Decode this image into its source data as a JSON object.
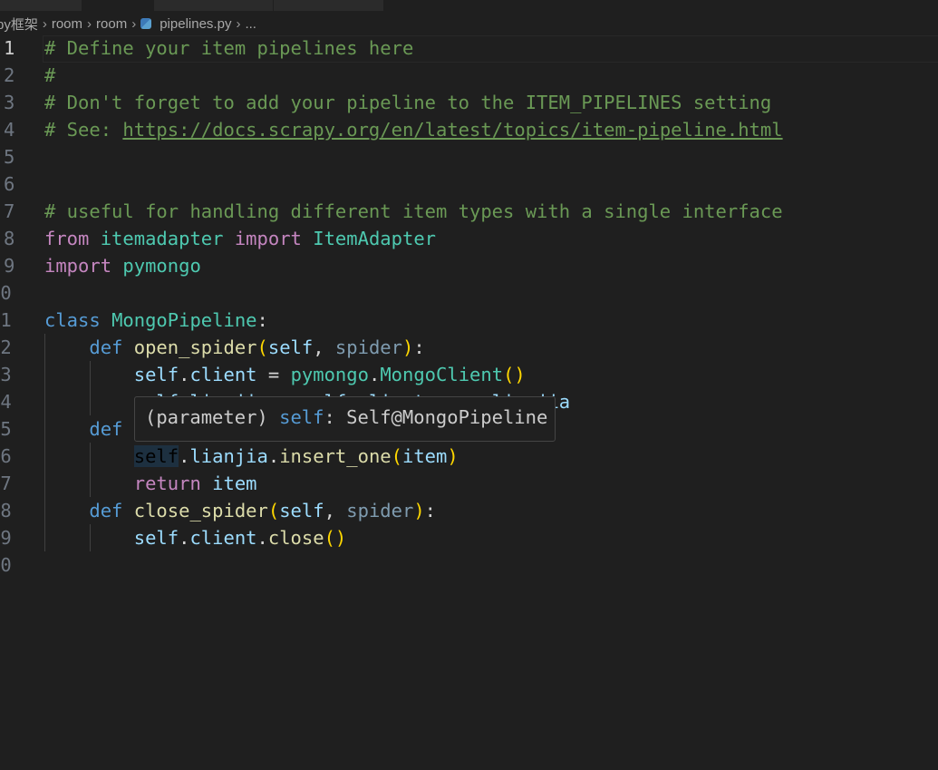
{
  "breadcrumb": [
    "py框架",
    "room",
    "room",
    "pipelines.py",
    "..."
  ],
  "file_icon": "python-icon",
  "current_line": 1,
  "lines": [
    [
      [
        "c",
        "# Define your item pipelines here"
      ]
    ],
    [
      [
        "c",
        "#"
      ]
    ],
    [
      [
        "c",
        "# Don't forget to add your pipeline to the ITEM_PIPELINES setting"
      ]
    ],
    [
      [
        "c",
        "# See: "
      ],
      [
        "u",
        "https://docs.scrapy.org/en/latest/topics/item-pipeline.html"
      ]
    ],
    [],
    [],
    [
      [
        "c",
        "# useful for handling different item types with a single interface"
      ]
    ],
    [
      [
        "k",
        "from"
      ],
      [
        "p",
        " "
      ],
      [
        "t",
        "itemadapter"
      ],
      [
        "p",
        " "
      ],
      [
        "k",
        "import"
      ],
      [
        "p",
        " "
      ],
      [
        "t",
        "ItemAdapter"
      ]
    ],
    [
      [
        "k",
        "import"
      ],
      [
        "p",
        " "
      ],
      [
        "t",
        "pymongo"
      ]
    ],
    [],
    [
      [
        "d",
        "class"
      ],
      [
        "p",
        " "
      ],
      [
        "t",
        "MongoPipeline"
      ],
      [
        "p",
        ":"
      ]
    ],
    [
      [
        "p",
        "    "
      ],
      [
        "d",
        "def"
      ],
      [
        "p",
        " "
      ],
      [
        "f",
        "open_spider"
      ],
      [
        "b",
        "("
      ],
      [
        "v",
        "self"
      ],
      [
        "p",
        ", "
      ],
      [
        "dim",
        "spider"
      ],
      [
        "b",
        ")"
      ],
      [
        "p",
        ":"
      ]
    ],
    [
      [
        "p",
        "        "
      ],
      [
        "v",
        "self"
      ],
      [
        "p",
        "."
      ],
      [
        "v",
        "client"
      ],
      [
        "p",
        " = "
      ],
      [
        "t",
        "pymongo"
      ],
      [
        "p",
        "."
      ],
      [
        "t",
        "MongoClient"
      ],
      [
        "b",
        "()"
      ]
    ],
    [
      [
        "p",
        "        "
      ],
      [
        "v",
        "self"
      ],
      [
        "p",
        "."
      ],
      [
        "v",
        "lianjia"
      ],
      [
        "p",
        " = "
      ],
      [
        "v",
        "self"
      ],
      [
        "p",
        "."
      ],
      [
        "v",
        "client"
      ],
      [
        "p",
        "."
      ],
      [
        "v",
        "room"
      ],
      [
        "p",
        "."
      ],
      [
        "v",
        "lianjia"
      ]
    ],
    [
      [
        "p",
        "    "
      ],
      [
        "d",
        "def"
      ]
    ],
    [
      [
        "p",
        "        "
      ],
      [
        "hl",
        "self"
      ],
      [
        "p",
        "."
      ],
      [
        "v",
        "lianjia"
      ],
      [
        "p",
        "."
      ],
      [
        "f",
        "insert_one"
      ],
      [
        "b",
        "("
      ],
      [
        "v",
        "item"
      ],
      [
        "b",
        ")"
      ]
    ],
    [
      [
        "p",
        "        "
      ],
      [
        "k",
        "return"
      ],
      [
        "p",
        " "
      ],
      [
        "v",
        "item"
      ]
    ],
    [
      [
        "p",
        "    "
      ],
      [
        "d",
        "def"
      ],
      [
        "p",
        " "
      ],
      [
        "f",
        "close_spider"
      ],
      [
        "b",
        "("
      ],
      [
        "v",
        "self"
      ],
      [
        "p",
        ", "
      ],
      [
        "dim",
        "spider"
      ],
      [
        "b",
        ")"
      ],
      [
        "p",
        ":"
      ]
    ],
    [
      [
        "p",
        "        "
      ],
      [
        "v",
        "self"
      ],
      [
        "p",
        "."
      ],
      [
        "v",
        "client"
      ],
      [
        "p",
        "."
      ],
      [
        "f",
        "close"
      ],
      [
        "b",
        "()"
      ]
    ],
    []
  ],
  "hover": {
    "prefix": "(parameter) ",
    "name": "self",
    "suffix": ": Self@MongoPipeline"
  }
}
